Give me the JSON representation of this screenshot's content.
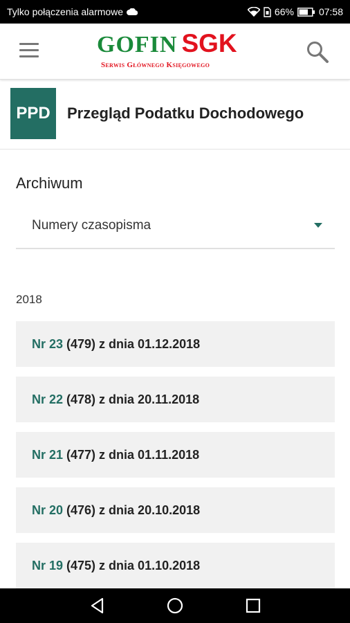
{
  "status_bar": {
    "carrier": "Tylko połączenia alarmowe",
    "battery": "66%",
    "time": "07:58"
  },
  "app_bar": {
    "logo_main": "GOFIN",
    "logo_accent": "SGK",
    "logo_subtitle": "Serwis Głównego Księgowego",
    "menu_icon": "hamburger-menu-icon",
    "search_icon": "search-icon"
  },
  "magazine": {
    "badge": "PPD",
    "title": "Przegląd Podatku Dochodowego",
    "badge_color": "#236e63"
  },
  "archive": {
    "label": "Archiwum",
    "dropdown_value": "Numery czasopisma",
    "year": "2018",
    "issues": [
      {
        "number": "Nr 23",
        "detail": "(479) z dnia 01.12.2018"
      },
      {
        "number": "Nr 22",
        "detail": "(478) z dnia 20.11.2018"
      },
      {
        "number": "Nr 21",
        "detail": "(477) z dnia 01.11.2018"
      },
      {
        "number": "Nr 20",
        "detail": "(476) z dnia 20.10.2018"
      },
      {
        "number": "Nr 19",
        "detail": "(475) z dnia 01.10.2018"
      }
    ]
  },
  "colors": {
    "accent": "#236e63",
    "logo_green": "#1a8a3a",
    "logo_red": "#e2121e"
  }
}
